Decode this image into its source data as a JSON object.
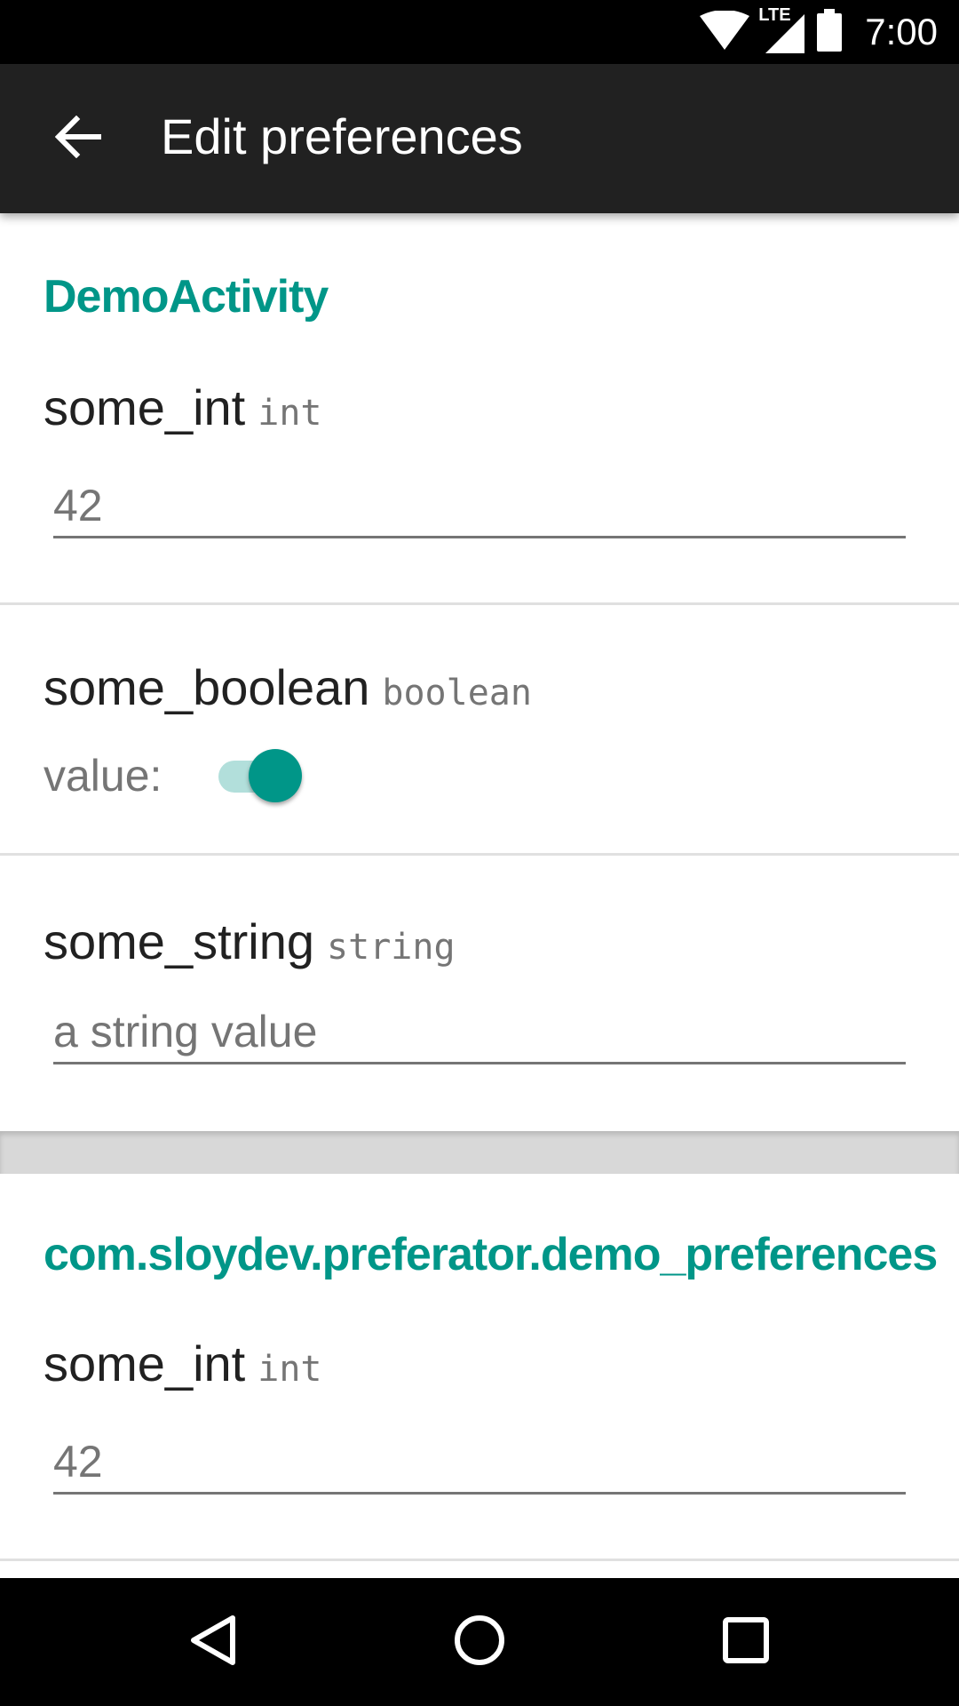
{
  "status_bar": {
    "time": "7:00",
    "network_label": "LTE",
    "icons": [
      "wifi-icon",
      "cellular-lte-icon",
      "battery-icon"
    ]
  },
  "app_bar": {
    "title": "Edit preferences",
    "back_icon": "arrow-back-icon"
  },
  "sections": [
    {
      "title": "DemoActivity",
      "prefs": [
        {
          "name": "some_int",
          "type": "int",
          "value": "42"
        },
        {
          "name": "some_boolean",
          "type": "boolean",
          "value_label": "value:",
          "checked": true
        },
        {
          "name": "some_string",
          "type": "string",
          "value": "a string value"
        }
      ]
    },
    {
      "title": "com.sloydev.preferator.demo_preferences",
      "prefs": [
        {
          "name": "some_int",
          "type": "int",
          "value": "42"
        }
      ]
    }
  ],
  "nav_bar": {
    "back_icon": "nav-back-icon",
    "home_icon": "nav-home-icon",
    "recents_icon": "nav-recents-icon"
  },
  "colors": {
    "accent": "#009688",
    "accent_light": "#b2dfdb",
    "app_bar": "#212121",
    "status_bar": "#000000"
  }
}
